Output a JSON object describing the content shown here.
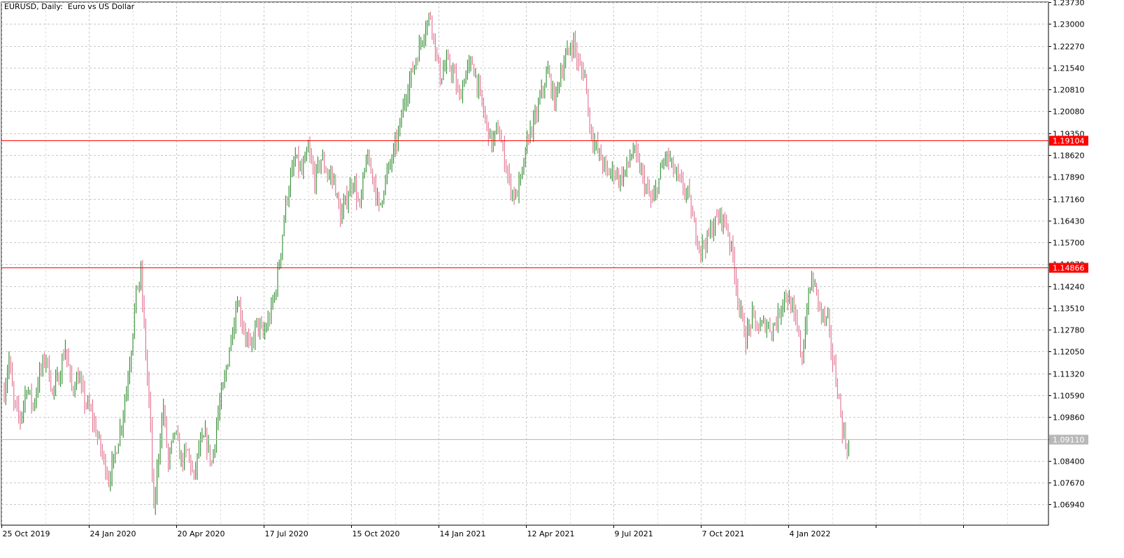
{
  "chart_data": {
    "type": "candlestick",
    "title": "EURUSD, Daily:  Euro vs US Dollar",
    "symbol": "EURUSD",
    "timeframe": "Daily",
    "description": "Euro vs US Dollar",
    "ylim": [
      1.0625,
      1.2373
    ],
    "y_ticks": [
      "1.23730",
      "1.23000",
      "1.22270",
      "1.21540",
      "1.20810",
      "1.20080",
      "1.19350",
      "1.18620",
      "1.17890",
      "1.17160",
      "1.16430",
      "1.15700",
      "1.14970",
      "1.14240",
      "1.13510",
      "1.12780",
      "1.12050",
      "1.11320",
      "1.10590",
      "1.09860",
      "1.09130",
      "1.08400",
      "1.07670",
      "1.06940"
    ],
    "x_ticks": [
      "25 Oct 2019",
      "24 Jan 2020",
      "20 Apr 2020",
      "17 Jul 2020",
      "15 Oct 2020",
      "14 Jan 2021",
      "12 Apr 2021",
      "9 Jul 2021",
      "7 Oct 2021",
      "4 Jan 2022"
    ],
    "grid": true,
    "bull_color": "#2e8b2e",
    "bear_color": "#e06f8c",
    "price_line_color": "#ff0000",
    "current_price_color": "#b8b8b8",
    "horizontal_lines": [
      {
        "label": "1.19104",
        "value": 1.19104,
        "color": "#ff0000"
      },
      {
        "label": "1.14866",
        "value": 1.14866,
        "color": "#ff0000"
      }
    ],
    "current_price": {
      "label": "1.09110",
      "value": 1.0911
    },
    "price_path": [
      [
        0,
        1.107
      ],
      [
        3,
        1.118
      ],
      [
        6,
        1.103
      ],
      [
        10,
        1.098
      ],
      [
        14,
        1.109
      ],
      [
        18,
        1.102
      ],
      [
        22,
        1.113
      ],
      [
        26,
        1.119
      ],
      [
        30,
        1.107
      ],
      [
        34,
        1.112
      ],
      [
        38,
        1.122
      ],
      [
        42,
        1.108
      ],
      [
        46,
        1.112
      ],
      [
        50,
        1.104
      ],
      [
        54,
        1.1
      ],
      [
        58,
        1.092
      ],
      [
        62,
        1.084
      ],
      [
        65,
        1.078
      ],
      [
        69,
        1.086
      ],
      [
        73,
        1.097
      ],
      [
        76,
        1.108
      ],
      [
        79,
        1.122
      ],
      [
        82,
        1.14
      ],
      [
        85,
        1.146
      ],
      [
        88,
        1.12
      ],
      [
        91,
        1.095
      ],
      [
        93,
        1.066
      ],
      [
        96,
        1.087
      ],
      [
        99,
        1.102
      ],
      [
        102,
        1.083
      ],
      [
        106,
        1.094
      ],
      [
        110,
        1.084
      ],
      [
        114,
        1.087
      ],
      [
        118,
        1.078
      ],
      [
        121,
        1.088
      ],
      [
        125,
        1.092
      ],
      [
        129,
        1.083
      ],
      [
        133,
        1.1
      ],
      [
        137,
        1.111
      ],
      [
        141,
        1.125
      ],
      [
        145,
        1.138
      ],
      [
        149,
        1.128
      ],
      [
        153,
        1.121
      ],
      [
        157,
        1.13
      ],
      [
        161,
        1.126
      ],
      [
        165,
        1.132
      ],
      [
        169,
        1.142
      ],
      [
        172,
        1.155
      ],
      [
        175,
        1.17
      ],
      [
        178,
        1.178
      ],
      [
        181,
        1.185
      ],
      [
        185,
        1.18
      ],
      [
        189,
        1.188
      ],
      [
        193,
        1.178
      ],
      [
        197,
        1.185
      ],
      [
        201,
        1.18
      ],
      [
        205,
        1.178
      ],
      [
        209,
        1.165
      ],
      [
        213,
        1.172
      ],
      [
        217,
        1.178
      ],
      [
        221,
        1.168
      ],
      [
        225,
        1.185
      ],
      [
        229,
        1.18
      ],
      [
        233,
        1.168
      ],
      [
        237,
        1.178
      ],
      [
        241,
        1.185
      ],
      [
        245,
        1.193
      ],
      [
        249,
        1.205
      ],
      [
        253,
        1.213
      ],
      [
        257,
        1.22
      ],
      [
        261,
        1.228
      ],
      [
        265,
        1.233
      ],
      [
        268,
        1.222
      ],
      [
        271,
        1.212
      ],
      [
        275,
        1.217
      ],
      [
        279,
        1.214
      ],
      [
        283,
        1.205
      ],
      [
        287,
        1.214
      ],
      [
        291,
        1.217
      ],
      [
        295,
        1.208
      ],
      [
        299,
        1.198
      ],
      [
        303,
        1.19
      ],
      [
        307,
        1.195
      ],
      [
        311,
        1.185
      ],
      [
        315,
        1.175
      ],
      [
        318,
        1.172
      ],
      [
        322,
        1.18
      ],
      [
        326,
        1.193
      ],
      [
        330,
        1.198
      ],
      [
        334,
        1.207
      ],
      [
        338,
        1.214
      ],
      [
        342,
        1.204
      ],
      [
        346,
        1.214
      ],
      [
        350,
        1.22
      ],
      [
        354,
        1.224
      ],
      [
        357,
        1.216
      ],
      [
        361,
        1.213
      ],
      [
        364,
        1.196
      ],
      [
        367,
        1.19
      ],
      [
        371,
        1.185
      ],
      [
        375,
        1.18
      ],
      [
        379,
        1.181
      ],
      [
        383,
        1.178
      ],
      [
        387,
        1.182
      ],
      [
        391,
        1.188
      ],
      [
        395,
        1.182
      ],
      [
        399,
        1.175
      ],
      [
        403,
        1.17
      ],
      [
        407,
        1.178
      ],
      [
        411,
        1.186
      ],
      [
        414,
        1.184
      ],
      [
        417,
        1.18
      ],
      [
        421,
        1.176
      ],
      [
        425,
        1.173
      ],
      [
        429,
        1.162
      ],
      [
        433,
        1.155
      ],
      [
        437,
        1.158
      ],
      [
        441,
        1.163
      ],
      [
        445,
        1.166
      ],
      [
        449,
        1.163
      ],
      [
        453,
        1.152
      ],
      [
        457,
        1.135
      ],
      [
        461,
        1.125
      ],
      [
        465,
        1.132
      ],
      [
        469,
        1.128
      ],
      [
        473,
        1.13
      ],
      [
        477,
        1.128
      ],
      [
        481,
        1.132
      ],
      [
        485,
        1.14
      ],
      [
        489,
        1.136
      ],
      [
        493,
        1.128
      ],
      [
        496,
        1.118
      ],
      [
        499,
        1.135
      ],
      [
        502,
        1.145
      ],
      [
        505,
        1.14
      ],
      [
        508,
        1.133
      ],
      [
        512,
        1.13
      ],
      [
        515,
        1.118
      ],
      [
        518,
        1.108
      ],
      [
        521,
        1.095
      ],
      [
        523,
        1.09
      ],
      [
        525,
        1.0875
      ]
    ]
  }
}
